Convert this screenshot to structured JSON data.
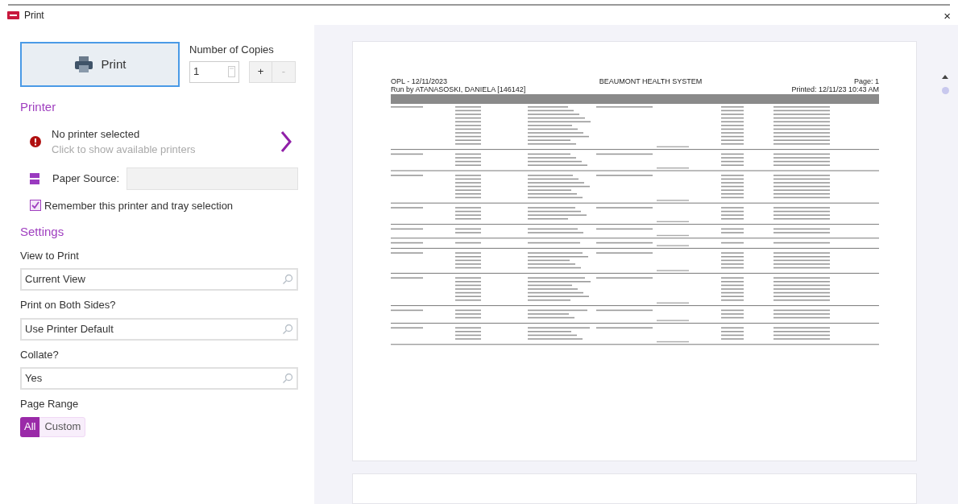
{
  "window": {
    "title": "Print",
    "close": "×"
  },
  "print_button": {
    "label": "Print"
  },
  "copies": {
    "label": "Number of Copies",
    "value": "1",
    "increment": "+",
    "decrement": "-"
  },
  "printer": {
    "heading": "Printer",
    "status": "No printer selected",
    "hint": "Click to show available printers",
    "paper_source_label": "Paper Source:",
    "remember": {
      "label": "Remember this printer and tray selection",
      "checked": true
    }
  },
  "settings": {
    "heading": "Settings",
    "fields": [
      {
        "label": "View to Print",
        "value": "Current View"
      },
      {
        "label": "Print on Both Sides?",
        "value": "Use Printer Default"
      },
      {
        "label": "Collate?",
        "value": "Yes"
      }
    ],
    "page_range": {
      "label": "Page Range",
      "options": [
        {
          "label": "All",
          "selected": true
        },
        {
          "label": "Custom",
          "selected": false
        }
      ]
    }
  },
  "preview": {
    "report_id": "OPL - 12/11/2023",
    "run_by": "Run by ATANASOSKI, DANIELA [146142]",
    "org": "BEAUMONT HEALTH SYSTEM",
    "page": "Page: 1",
    "printed": "Printed: 12/11/23 10:43 AM"
  }
}
